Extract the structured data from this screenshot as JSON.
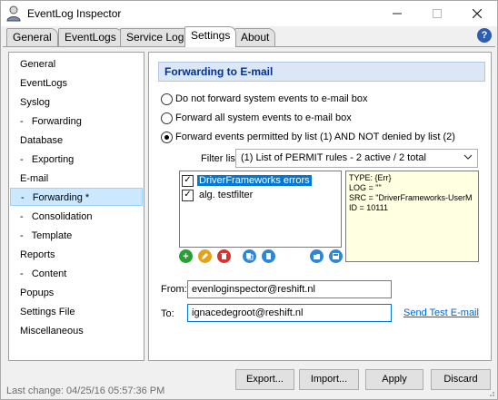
{
  "window": {
    "title": "EventLog Inspector",
    "icon": "user-shield-icon",
    "controls": [
      "minimize-icon",
      "maximize-icon",
      "close-icon"
    ]
  },
  "tabs": [
    {
      "label": "General",
      "active": false
    },
    {
      "label": "EventLogs",
      "active": false
    },
    {
      "label": "Service Log",
      "active": false
    },
    {
      "label": "Settings",
      "active": true
    },
    {
      "label": "About",
      "active": false
    }
  ],
  "help_icon": "?",
  "sidebar": {
    "items": [
      {
        "label": "General",
        "selected": false
      },
      {
        "label": "EventLogs",
        "selected": false
      },
      {
        "label": "Syslog",
        "selected": false
      },
      {
        "label": "-   Forwarding",
        "selected": false
      },
      {
        "label": "Database",
        "selected": false
      },
      {
        "label": "-   Exporting",
        "selected": false
      },
      {
        "label": "E-mail",
        "selected": false
      },
      {
        "label": "-   Forwarding *",
        "selected": true
      },
      {
        "label": "-   Consolidation",
        "selected": false
      },
      {
        "label": "-   Template",
        "selected": false
      },
      {
        "label": "Reports",
        "selected": false
      },
      {
        "label": "-   Content",
        "selected": false
      },
      {
        "label": "Popups",
        "selected": false
      },
      {
        "label": "Settings File",
        "selected": false
      },
      {
        "label": "Miscellaneous",
        "selected": false
      }
    ]
  },
  "panel": {
    "header": "Forwarding to E-mail",
    "radios": [
      {
        "label": "Do not forward system events to e-mail box",
        "checked": false
      },
      {
        "label": "Forward all system events to e-mail box",
        "checked": false
      },
      {
        "label": "Forward events permitted by list (1) AND NOT denied by list (2)",
        "checked": true
      }
    ],
    "filter_label": "Filter list:",
    "filter_value": "(1) List of PERMIT rules - 2 active / 2 total",
    "filters": [
      {
        "label": "DriverFrameworks errors",
        "checked": true,
        "highlighted": true
      },
      {
        "label": "alg. testfilter",
        "checked": true,
        "highlighted": false
      }
    ],
    "detail_lines": [
      "TYPE: {Err}",
      "LOG = \"\"",
      "SRC = \"DriverFrameworks-UserM",
      "ID = 10111"
    ],
    "tool_icons": [
      "add-icon",
      "edit-icon",
      "delete-icon",
      "copy-icon",
      "paste-icon",
      "open-icon",
      "save-icon"
    ],
    "from_label": "From:",
    "from_value": "evenloginspector@reshift.nl",
    "to_label": "To:",
    "to_value": "ignacedegroot@reshift.nl",
    "send_test_label": "Send Test E-mail"
  },
  "footer": {
    "status": "Last change: 04/25/16 05:57:36 PM",
    "export_label": "Export...",
    "import_label": "Import...",
    "apply_label": "Apply",
    "discard_label": "Discard"
  },
  "colors": {
    "accent": "#0078d7",
    "header_bg": "#dbe7f4",
    "header_text": "#003399",
    "selection_bg": "#cce8ff",
    "detail_bg": "#ffffe1",
    "link": "#0066cc"
  }
}
